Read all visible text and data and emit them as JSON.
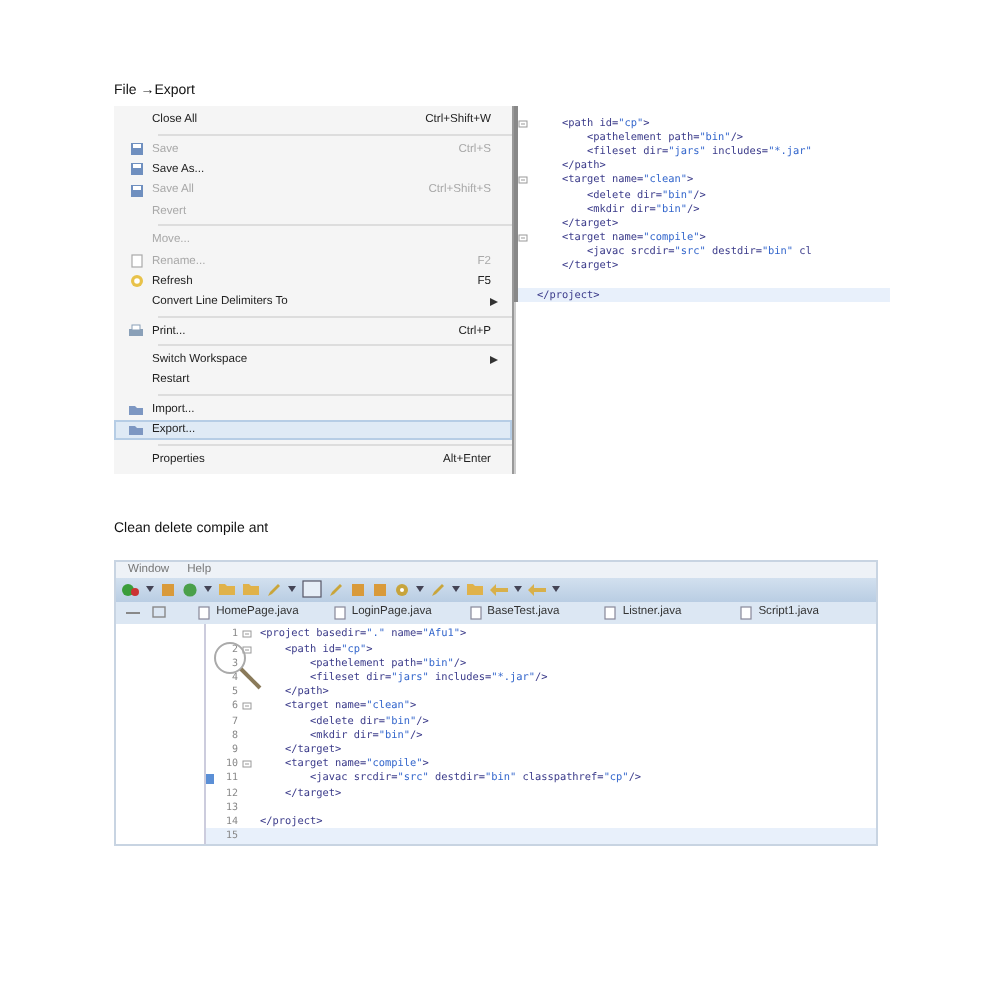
{
  "caption_1": "File →Export",
  "file_menu": {
    "groups": [
      [
        {
          "label": "Close All",
          "shortcut": "Ctrl+Shift+W",
          "disabled": false,
          "submenu": false,
          "selected": false
        }
      ],
      [
        {
          "label": "Save",
          "shortcut": "Ctrl+S",
          "disabled": true,
          "submenu": false,
          "selected": false
        },
        {
          "label": "Save As...",
          "disabled": false,
          "submenu": false,
          "selected": false
        },
        {
          "label": "Save All",
          "shortcut": "Ctrl+Shift+S",
          "disabled": true,
          "submenu": false,
          "selected": false
        },
        {
          "label": "Revert",
          "disabled": true,
          "submenu": false,
          "selected": false
        }
      ],
      [
        {
          "label": "Move...",
          "disabled": true,
          "submenu": false,
          "selected": false
        },
        {
          "label": "Rename...",
          "shortcut": "F2",
          "disabled": true,
          "submenu": false,
          "selected": false
        },
        {
          "label": "Refresh",
          "shortcut": "F5",
          "disabled": false,
          "submenu": false,
          "selected": false
        },
        {
          "label": "Convert Line Delimiters To",
          "disabled": false,
          "submenu": true,
          "selected": false
        }
      ],
      [
        {
          "label": "Print...",
          "shortcut": "Ctrl+P",
          "disabled": false,
          "submenu": false,
          "selected": false
        }
      ],
      [
        {
          "label": "Switch Workspace",
          "disabled": false,
          "submenu": true,
          "selected": false
        },
        {
          "label": "Restart",
          "disabled": false,
          "submenu": false,
          "selected": false
        }
      ],
      [
        {
          "label": "Import...",
          "disabled": false,
          "submenu": false,
          "selected": false
        },
        {
          "label": "Export...",
          "disabled": false,
          "submenu": false,
          "selected": true
        }
      ],
      [
        {
          "label": "Properties",
          "shortcut": "Alt+Enter",
          "disabled": false,
          "submenu": false,
          "selected": false
        }
      ]
    ]
  },
  "editor_1": {
    "lines": [
      {
        "text": "    <path id=\"cp\">",
        "fold": true,
        "current": false
      },
      {
        "text": "        <pathelement path=\"bin\"/>",
        "fold": false,
        "current": false
      },
      {
        "text": "        <fileset dir=\"jars\" includes=\"*.jar\"",
        "fold": false,
        "current": false
      },
      {
        "text": "    </path>",
        "fold": false,
        "current": false
      },
      {
        "text": "    <target name=\"clean\">",
        "fold": true,
        "current": false
      },
      {
        "text": "        <delete dir=\"bin\"/>",
        "fold": false,
        "current": false
      },
      {
        "text": "        <mkdir dir=\"bin\"/>",
        "fold": false,
        "current": false
      },
      {
        "text": "    </target>",
        "fold": false,
        "current": false
      },
      {
        "text": "    <target name=\"compile\">",
        "fold": true,
        "current": false
      },
      {
        "text": "        <javac srcdir=\"src\" destdir=\"bin\" cl",
        "fold": false,
        "current": false
      },
      {
        "text": "    </target>",
        "fold": false,
        "current": false
      },
      {
        "fold": false,
        "current": false
      },
      {
        "text": "</project>",
        "fold": false,
        "current": true
      }
    ]
  },
  "caption_2": "Clean delete compile ant",
  "eclipse": {
    "menu": [
      "Window",
      "Help"
    ],
    "tabs": [
      {
        "label": "HomePage.java",
        "selected": false
      },
      {
        "label": "LoginPage.java",
        "selected": false
      },
      {
        "label": "BaseTest.java",
        "selected": false
      },
      {
        "label": "Listner.java",
        "selected": false
      },
      {
        "label": "Script1.java",
        "selected": false
      }
    ],
    "lines": [
      {
        "number": "1",
        "fold": true,
        "text": "<project basedir=\".\" name=\"Afu1\">",
        "current": false,
        "marker": false
      },
      {
        "number": "2",
        "fold": true,
        "text": "    <path id=\"cp\">",
        "current": false,
        "marker": false
      },
      {
        "number": "3",
        "fold": false,
        "text": "        <pathelement path=\"bin\"/>",
        "current": false,
        "marker": false
      },
      {
        "number": "4",
        "fold": false,
        "text": "        <fileset dir=\"jars\" includes=\"*.jar\"/>",
        "current": false,
        "marker": false
      },
      {
        "number": "5",
        "fold": false,
        "text": "    </path>",
        "current": false,
        "marker": false
      },
      {
        "number": "6",
        "fold": true,
        "text": "    <target name=\"clean\">",
        "current": false,
        "marker": false
      },
      {
        "number": "7",
        "fold": false,
        "text": "        <delete dir=\"bin\"/>",
        "current": false,
        "marker": false
      },
      {
        "number": "8",
        "fold": false,
        "text": "        <mkdir dir=\"bin\"/>",
        "current": false,
        "marker": false
      },
      {
        "number": "9",
        "fold": false,
        "text": "    </target>",
        "current": false,
        "marker": false
      },
      {
        "number": "10",
        "fold": true,
        "text": "    <target name=\"compile\">",
        "current": false,
        "marker": false
      },
      {
        "number": "11",
        "fold": false,
        "text": "        <javac srcdir=\"src\" destdir=\"bin\" classpathref=\"cp\"/>",
        "current": false,
        "marker": true
      },
      {
        "number": "12",
        "fold": false,
        "text": "    </target>",
        "current": false,
        "marker": false
      },
      {
        "number": "13",
        "fold": false,
        "current": false,
        "marker": false
      },
      {
        "number": "14",
        "fold": false,
        "text": "</project>",
        "current": false,
        "marker": false
      },
      {
        "number": "15",
        "fold": false,
        "current": true,
        "marker": false
      }
    ]
  }
}
